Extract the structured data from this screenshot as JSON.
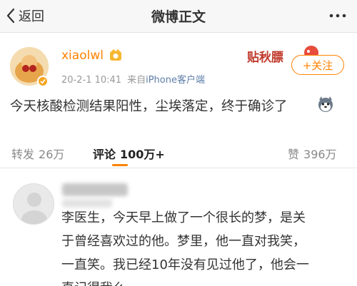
{
  "navbar": {
    "back_label": "返回",
    "title": "微博正文",
    "more_icon": "more-dots-icon"
  },
  "post": {
    "username": "xiaolwl",
    "date_time": "20-2-1 10:41",
    "source_prefix": "来自",
    "source_name": "iPhone客户端",
    "follow_label": "+关注",
    "text": "今天核酸检测结果阳性，尘埃落定，终于确诊了",
    "sticker_text": "贴秋膘",
    "colors": {
      "accent": "#ff8200",
      "link": "#5d7ea8",
      "meta": "#999999"
    }
  },
  "tabs": {
    "repost_label": "转发",
    "repost_count": "26万",
    "comment_label": "评论",
    "comment_count": "100万+",
    "like_label": "赞",
    "like_count": "396万"
  },
  "comment": {
    "lines": [
      "李医生，今天早上做了一个很长的梦，是关",
      "于曾经喜欢过的他。梦里，他一直对我笑，",
      "一直笑。我已经10年没有见过他了，他会一",
      "直记得我么"
    ]
  }
}
